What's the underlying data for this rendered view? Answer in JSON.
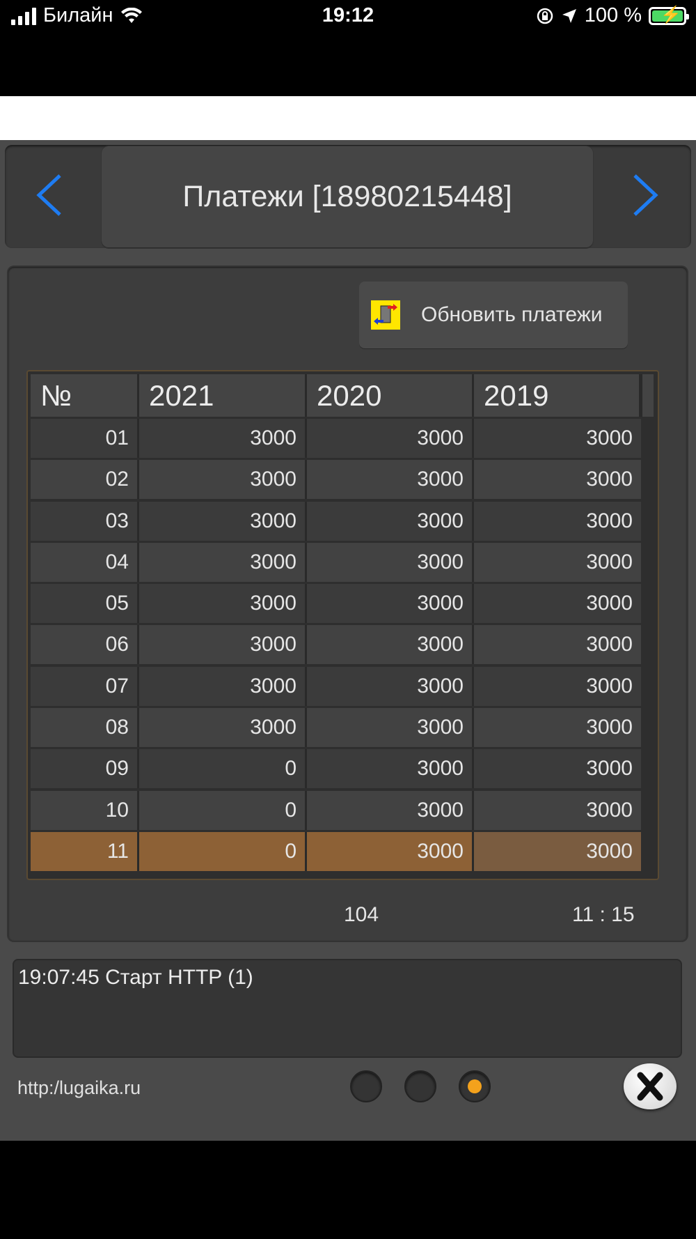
{
  "status_bar": {
    "carrier": "Билайн",
    "time": "19:12",
    "battery": "100 %"
  },
  "header": {
    "title": "Платежи [18980215448]",
    "prev_icon": "chevron-left-icon",
    "next_icon": "chevron-right-icon",
    "accent_color": "#1e7cf2"
  },
  "toolbar": {
    "refresh_label": "Обновить платежи",
    "refresh_icon": "transfer-icon"
  },
  "table": {
    "columns": [
      "№",
      "2021",
      "2020",
      "2019"
    ],
    "rows": [
      [
        "01",
        "3000",
        "3000",
        "3000"
      ],
      [
        "02",
        "3000",
        "3000",
        "3000"
      ],
      [
        "03",
        "3000",
        "3000",
        "3000"
      ],
      [
        "04",
        "3000",
        "3000",
        "3000"
      ],
      [
        "05",
        "3000",
        "3000",
        "3000"
      ],
      [
        "06",
        "3000",
        "3000",
        "3000"
      ],
      [
        "07",
        "3000",
        "3000",
        "3000"
      ],
      [
        "08",
        "3000",
        "3000",
        "3000"
      ],
      [
        "09",
        "0",
        "3000",
        "3000"
      ],
      [
        "10",
        "0",
        "3000",
        "3000"
      ],
      [
        "11",
        "0",
        "3000",
        "3000"
      ]
    ],
    "selected_row": "11",
    "selected_color": "#8d6136"
  },
  "footer": {
    "count": "104",
    "time": "11 : 15"
  },
  "log": {
    "text": "19:07:45 Старт HTTP (1)"
  },
  "bottom": {
    "site": "http:/lugaika.ru",
    "pages": 3,
    "active_page": 3,
    "active_color": "#f4a21c",
    "close_icon": "close-icon"
  }
}
